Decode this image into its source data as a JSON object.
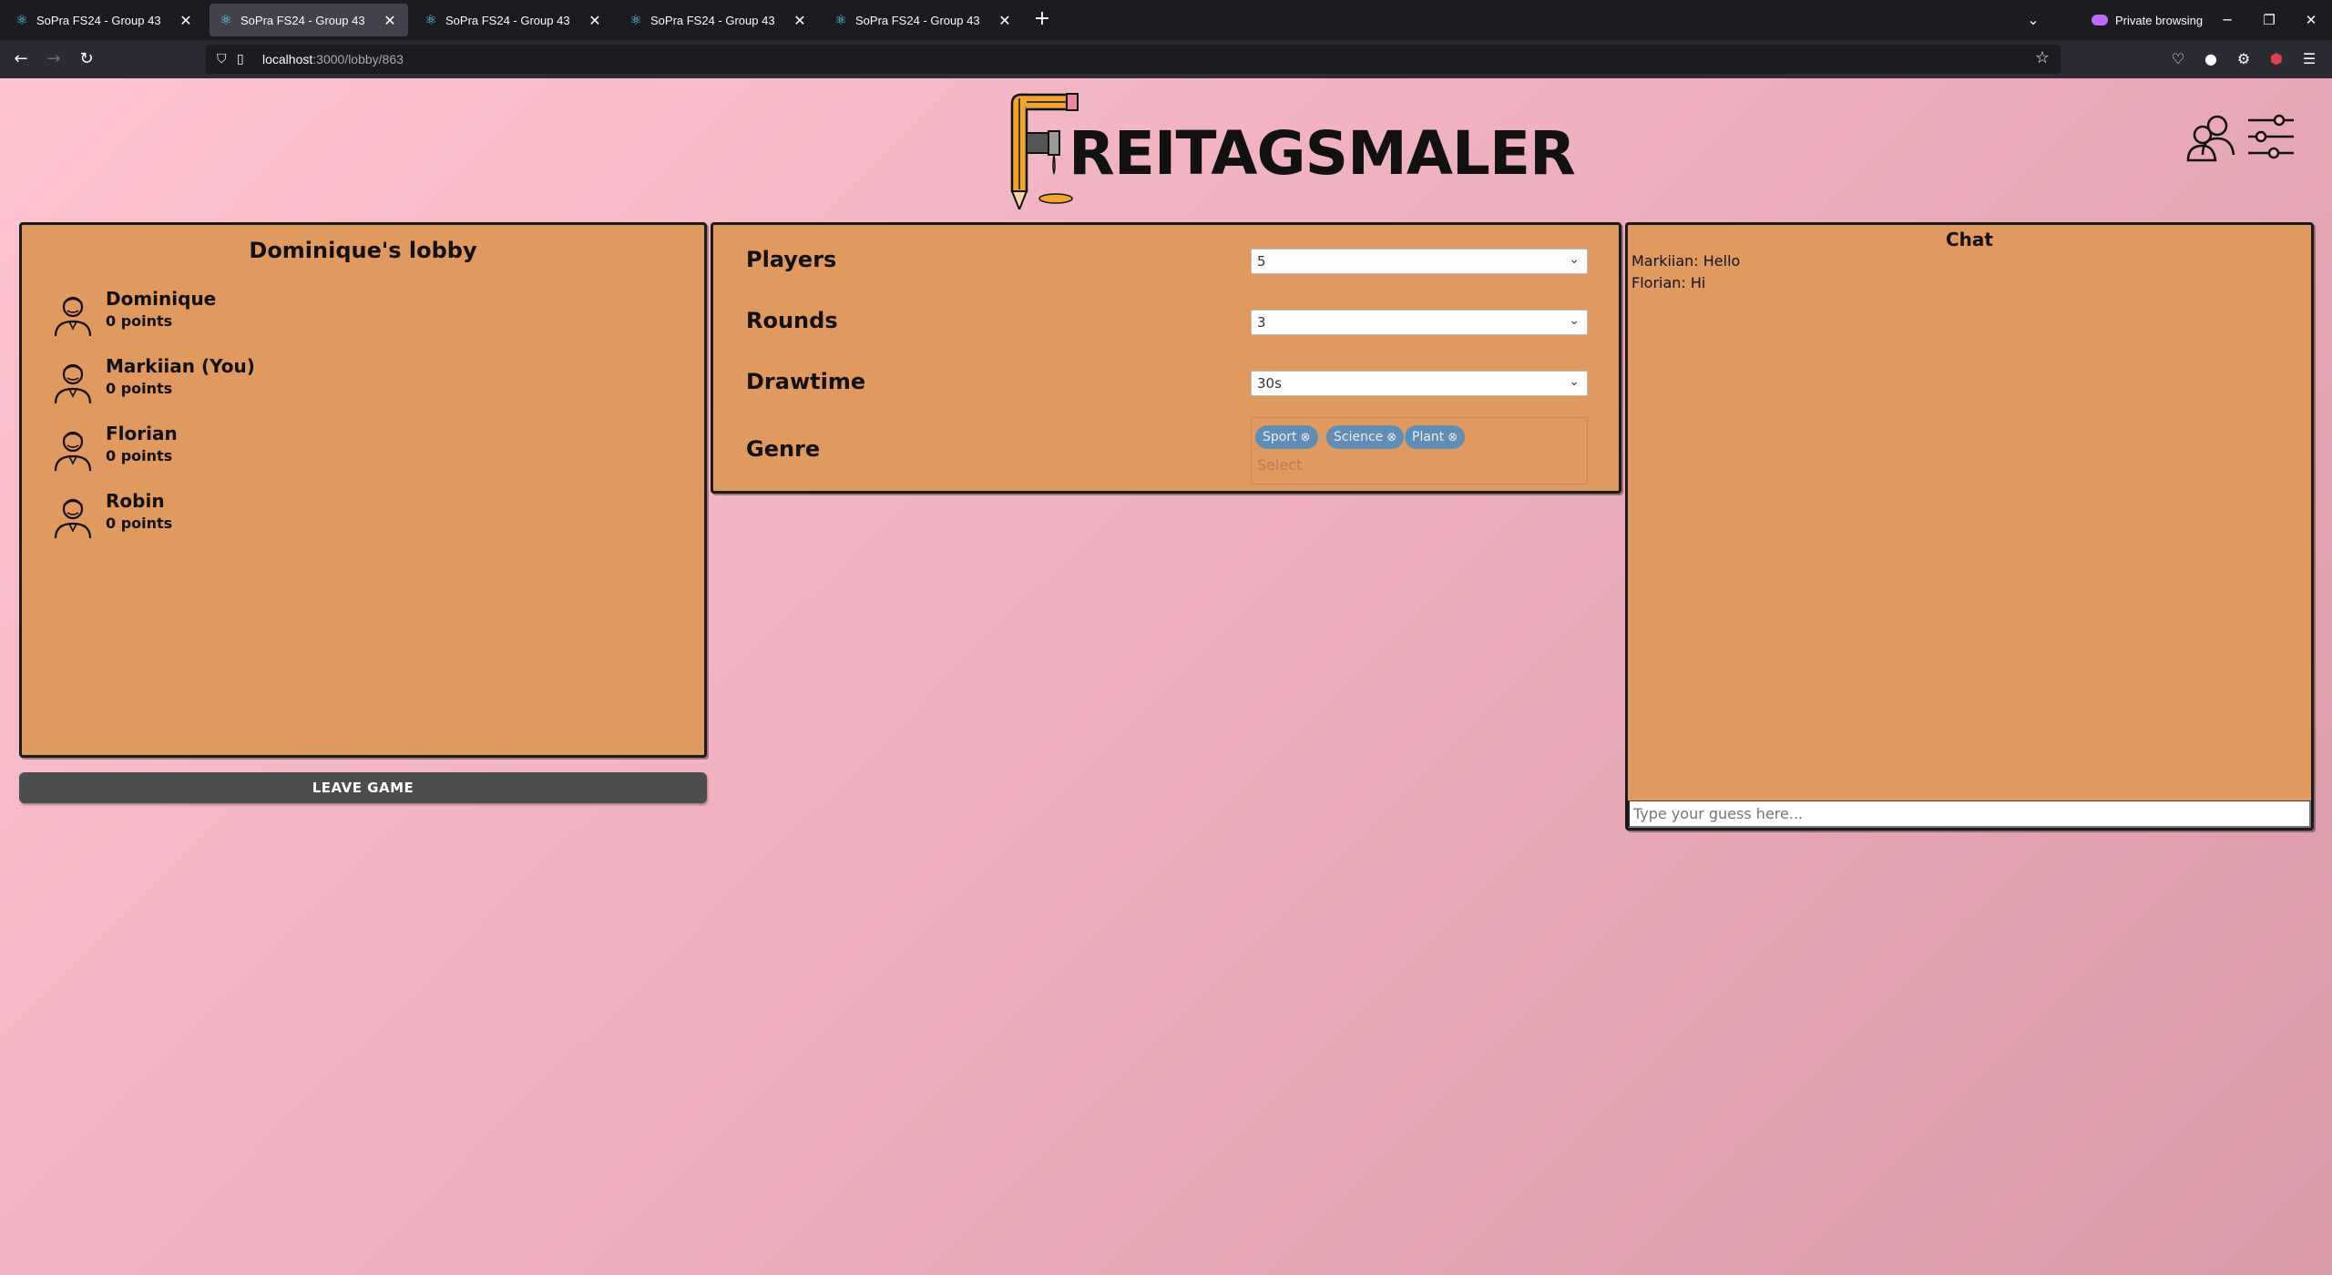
{
  "browser": {
    "tabs": [
      {
        "label": "SoPra FS24 - Group 43",
        "active": false
      },
      {
        "label": "SoPra FS24 - Group 43",
        "active": true
      },
      {
        "label": "SoPra FS24 - Group 43",
        "active": false
      },
      {
        "label": "SoPra FS24 - Group 43",
        "active": false
      },
      {
        "label": "SoPra FS24 - Group 43",
        "active": false
      }
    ],
    "private_label": "Private browsing",
    "url_host": "localhost",
    "url_path": ":3000/lobby/863"
  },
  "logo": {
    "word": "REITAGSMALER"
  },
  "lobby": {
    "title": "Dominique's lobby",
    "players": [
      {
        "name": "Dominique",
        "points": "0 points"
      },
      {
        "name": "Markiian (You)",
        "points": "0 points"
      },
      {
        "name": "Florian",
        "points": "0 points"
      },
      {
        "name": "Robin",
        "points": "0 points"
      }
    ],
    "leave_label": "LEAVE GAME"
  },
  "settings": {
    "players_label": "Players",
    "players_value": "5",
    "rounds_label": "Rounds",
    "rounds_value": "3",
    "drawtime_label": "Drawtime",
    "drawtime_value": "30s",
    "genre_label": "Genre",
    "genres": [
      "Sport",
      "Science",
      "Plant"
    ],
    "genre_placeholder": "Select"
  },
  "chat": {
    "title": "Chat",
    "messages": [
      "Markiian: Hello",
      "Florian: Hi"
    ],
    "input_placeholder": "Type your guess here..."
  },
  "colors": {
    "panel": "#e0995f",
    "background": "#f5b4c4",
    "chip": "#5f8db3",
    "leave_button": "#4d4d4d"
  }
}
